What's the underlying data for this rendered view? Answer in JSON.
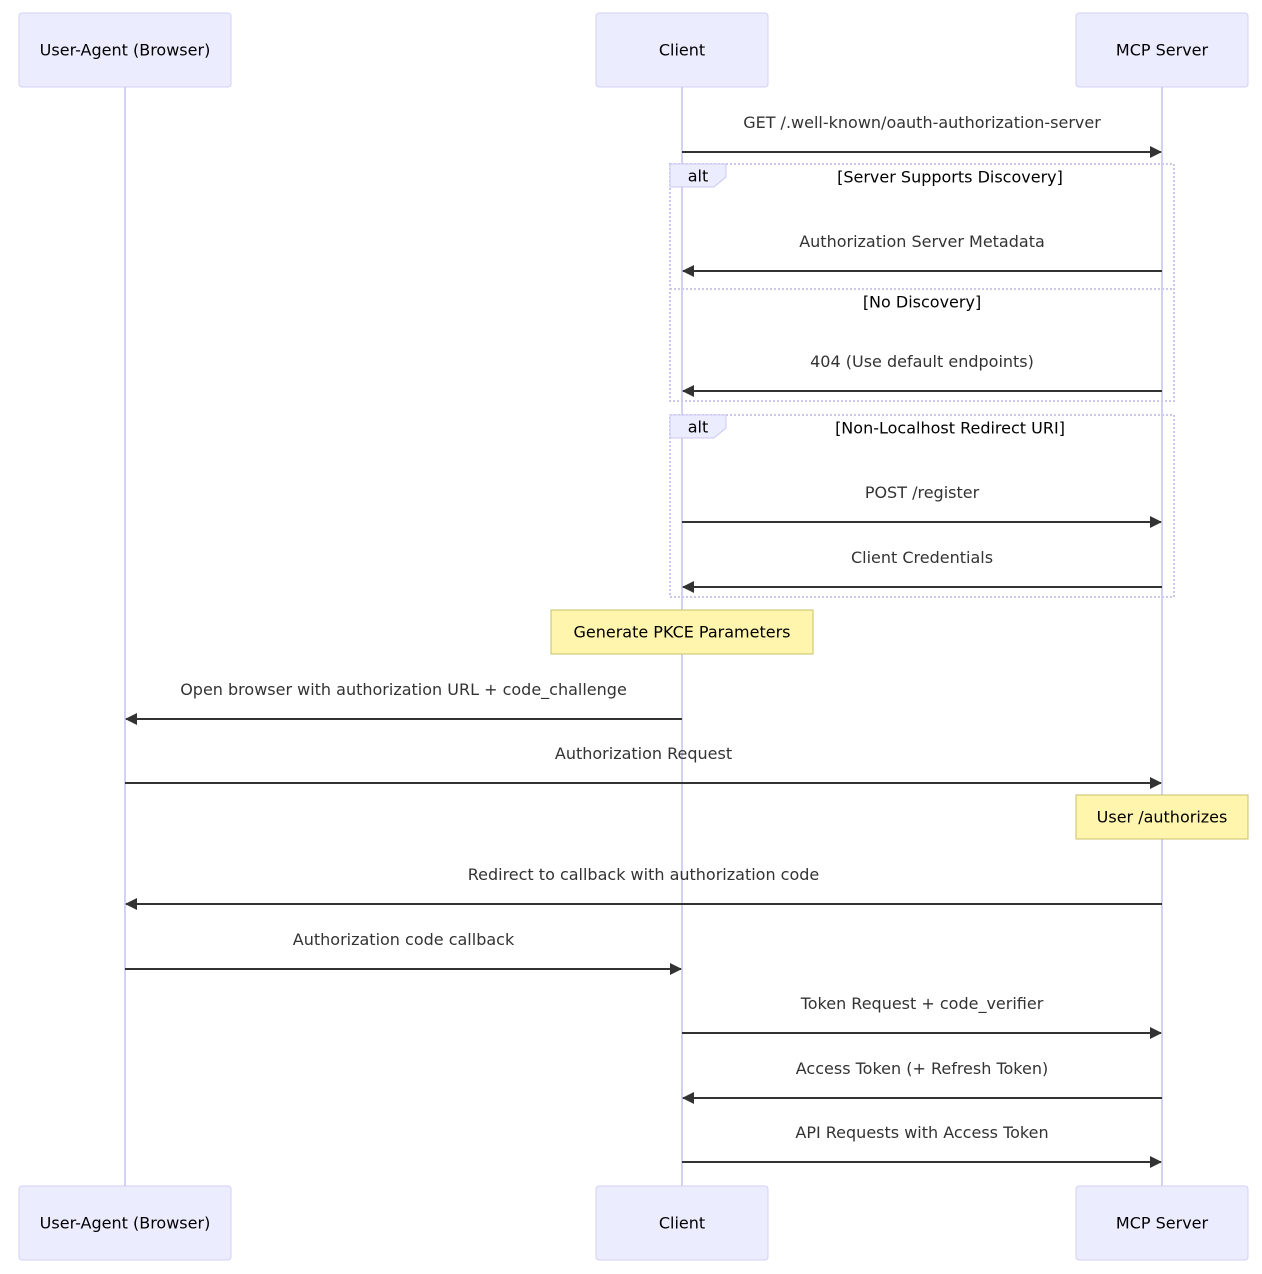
{
  "diagram": {
    "type": "sequence",
    "colors": {
      "actor_fill": "#ececff",
      "actor_border": "#d3d0f5",
      "lifeline": "#d3d0f5",
      "message": "#333333",
      "note_fill": "#fff5ad",
      "note_border": "#c9bf6a",
      "frame_border": "#cbc8f0"
    },
    "actors": [
      {
        "id": "ua",
        "label": "User-Agent (Browser)"
      },
      {
        "id": "client",
        "label": "Client"
      },
      {
        "id": "server",
        "label": "MCP Server"
      }
    ],
    "events": [
      {
        "kind": "message",
        "from": "client",
        "to": "server",
        "label": "GET /.well-known/oauth-authorization-server"
      },
      {
        "kind": "alt_start",
        "label": "alt",
        "condition": "[Server Supports Discovery]"
      },
      {
        "kind": "message",
        "from": "server",
        "to": "client",
        "label": "Authorization Server Metadata"
      },
      {
        "kind": "alt_else",
        "condition": "[No Discovery]"
      },
      {
        "kind": "message",
        "from": "server",
        "to": "client",
        "label": "404 (Use default endpoints)"
      },
      {
        "kind": "alt_end"
      },
      {
        "kind": "alt_start",
        "label": "alt",
        "condition": "[Non-Localhost Redirect URI]"
      },
      {
        "kind": "message",
        "from": "client",
        "to": "server",
        "label": "POST /register"
      },
      {
        "kind": "message",
        "from": "server",
        "to": "client",
        "label": "Client Credentials"
      },
      {
        "kind": "alt_end"
      },
      {
        "kind": "note",
        "over": "client",
        "label": "Generate PKCE Parameters"
      },
      {
        "kind": "message",
        "from": "client",
        "to": "ua",
        "label": "Open browser with authorization URL + code_challenge"
      },
      {
        "kind": "message",
        "from": "ua",
        "to": "server",
        "label": "Authorization Request"
      },
      {
        "kind": "note",
        "over": "server",
        "label": "User /authorizes"
      },
      {
        "kind": "message",
        "from": "server",
        "to": "ua",
        "label": "Redirect to callback with authorization code"
      },
      {
        "kind": "message",
        "from": "ua",
        "to": "client",
        "label": "Authorization code callback"
      },
      {
        "kind": "message",
        "from": "client",
        "to": "server",
        "label": "Token Request + code_verifier"
      },
      {
        "kind": "message",
        "from": "server",
        "to": "client",
        "label": "Access Token (+ Refresh Token)"
      },
      {
        "kind": "message",
        "from": "client",
        "to": "server",
        "label": "API Requests with Access Token"
      }
    ]
  }
}
